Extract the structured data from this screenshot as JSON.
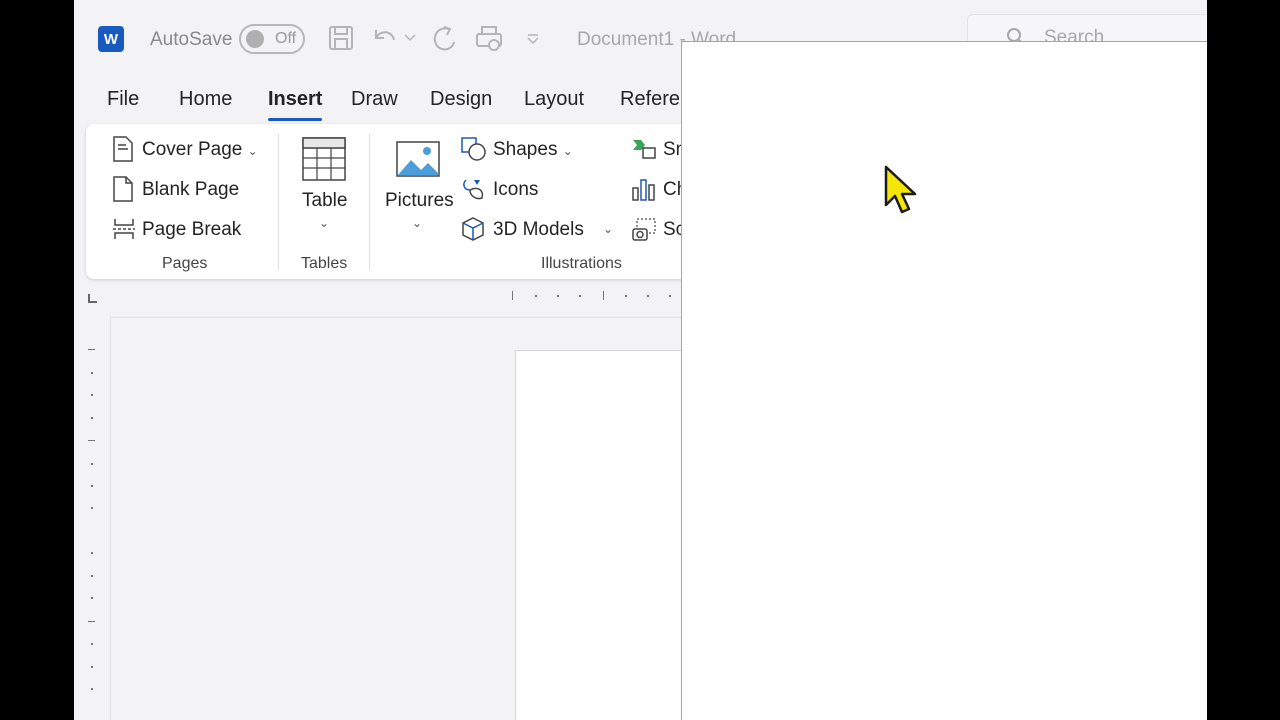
{
  "titlebar": {
    "app_logo_letter": "W",
    "autosave_label": "AutoSave",
    "autosave_state": "Off",
    "doc_title": "Document1 - Word",
    "search_placeholder": "Search"
  },
  "tabs": [
    {
      "label": "File"
    },
    {
      "label": "Home"
    },
    {
      "label": "Insert"
    },
    {
      "label": "Draw"
    },
    {
      "label": "Design"
    },
    {
      "label": "Layout"
    },
    {
      "label": "Refere"
    }
  ],
  "ribbon": {
    "pages": {
      "cover_page": "Cover Page",
      "blank_page": "Blank Page",
      "page_break": "Page Break",
      "group_label": "Pages"
    },
    "tables": {
      "table": "Table",
      "group_label": "Tables"
    },
    "illustrations": {
      "pictures": "Pictures",
      "shapes": "Shapes",
      "icons": "Icons",
      "models_3d": "3D Models",
      "smartart_partial": "Sn",
      "chart_partial": "Ch",
      "screenshot_partial": "Sc",
      "group_label": "Illustrations"
    }
  },
  "colors": {
    "accent": "#185abd",
    "app_bg": "#f3f2f5",
    "cursor_fill": "#f5e60a"
  }
}
